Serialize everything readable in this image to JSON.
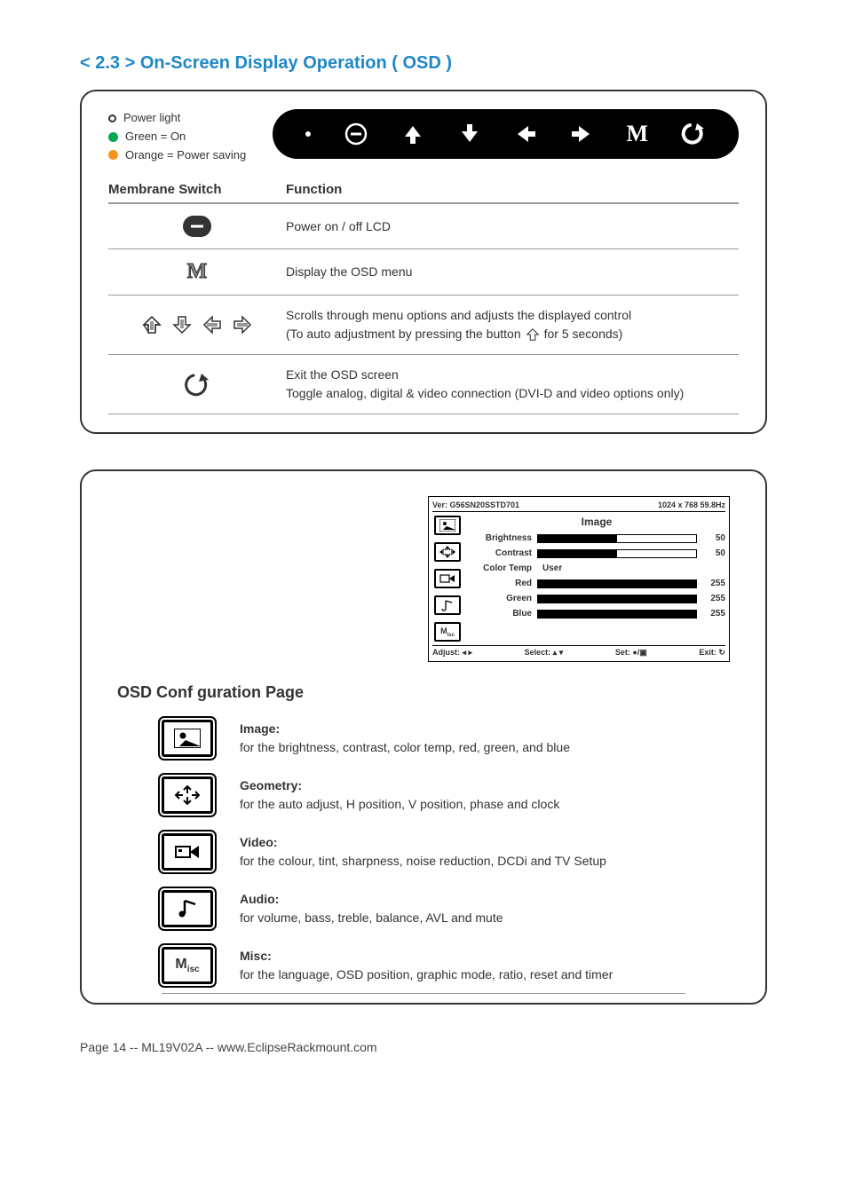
{
  "section_title": "< 2.3 > On-Screen Display Operation ( OSD )",
  "legend": {
    "power_light": "Power light",
    "green_on": "Green = On",
    "orange_saving": "Orange = Power saving"
  },
  "table": {
    "header_switch": "Membrane Switch",
    "header_function": "Function",
    "rows": {
      "power": "Power on / off LCD",
      "menu": "Display the OSD menu",
      "arrows_line1": "Scrolls through menu options and adjusts the displayed control",
      "arrows_line2a": "(To auto adjustment by pressing the button",
      "arrows_line2b": "for 5 seconds)",
      "exit_line1": "Exit the OSD screen",
      "exit_line2": "Toggle analog, digital & video connection (DVI-D and video options only)"
    }
  },
  "osd": {
    "version": "Ver: G56SN20SSTD701",
    "res": "1024 x 768  59.8Hz",
    "misc_label": "Misc",
    "heading": "Image",
    "rows": {
      "brightness": {
        "label": "Brightness",
        "val": "50",
        "pct": 50
      },
      "contrast": {
        "label": "Contrast",
        "val": "50",
        "pct": 50
      },
      "colortemp": {
        "label": "Color Temp",
        "val": "User"
      },
      "red": {
        "label": "Red",
        "val": "255",
        "pct": 100
      },
      "green": {
        "label": "Green",
        "val": "255",
        "pct": 100
      },
      "blue": {
        "label": "Blue",
        "val": "255",
        "pct": 100
      }
    },
    "footer": {
      "adjust": "Adjust: ◂ ▸",
      "select": "Select: ▴ ▾",
      "set": "Set: ●/▣",
      "exit": "Exit: ↻"
    }
  },
  "conf_title": "OSD Conf guration Page",
  "conf": {
    "image": {
      "title": "Image:",
      "desc": "for the brightness, contrast, color temp, red, green, and blue"
    },
    "geometry": {
      "title": "Geometry:",
      "desc": "for the auto adjust, H position, V position, phase and clock"
    },
    "video": {
      "title": "Video:",
      "desc": "for the colour, tint, sharpness, noise reduction, DCDi and TV Setup"
    },
    "audio": {
      "title": "Audio:",
      "desc": "for volume, bass, treble, balance, AVL and mute"
    },
    "misc": {
      "title": "Misc:",
      "desc": "for the language, OSD position, graphic mode, ratio, reset and timer"
    }
  },
  "footer_text": "Page 14 -- ML19V02A -- www.EclipseRackmount.com"
}
